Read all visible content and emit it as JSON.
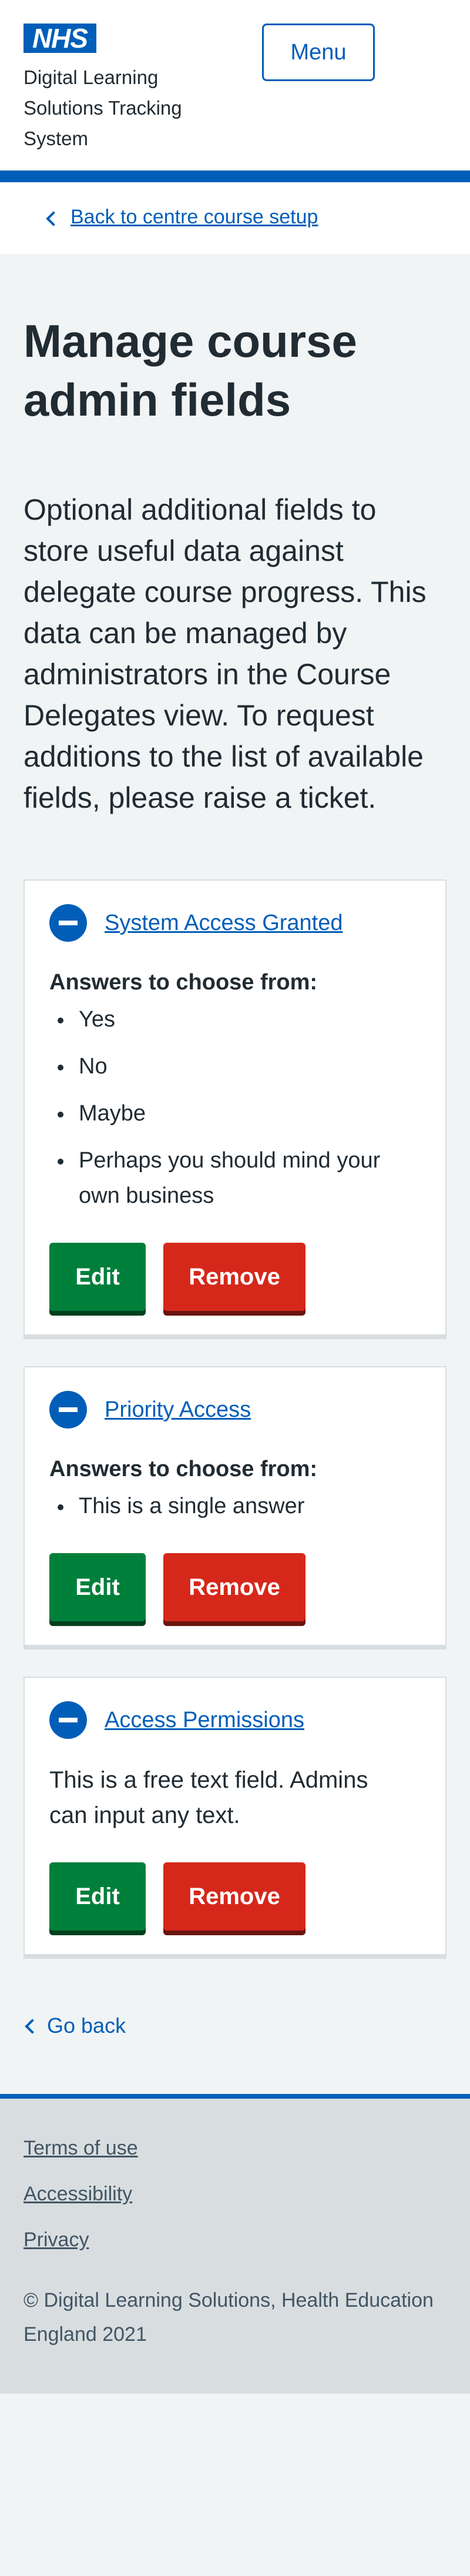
{
  "header": {
    "logo_text": "NHS",
    "service_name": "Digital Learning Solutions Tracking System",
    "menu_label": "Menu"
  },
  "breadcrumb": {
    "back_label": "Back to centre course setup"
  },
  "main": {
    "title": "Manage course admin fields",
    "lede": "Optional additional fields to store useful data against delegate course progress. This data can be managed by administrators in the Course Delegates view. To request additions to the list of available fields, please raise a ticket.",
    "answers_heading": "Answers to choose from:",
    "edit_label": "Edit",
    "remove_label": "Remove",
    "fields": [
      {
        "name": "System Access Granted",
        "answers": [
          "Yes",
          "No",
          "Maybe",
          "Perhaps you should mind your own business"
        ]
      },
      {
        "name": "Priority Access",
        "answers": [
          "This is a single answer"
        ]
      },
      {
        "name": "Access Permissions",
        "free_text": "This is a free text field. Admins can input any text."
      }
    ],
    "go_back_label": "Go back"
  },
  "footer": {
    "links": [
      "Terms of use",
      "Accessibility",
      "Privacy"
    ],
    "copyright": "© Digital Learning Solutions, Health Education England 2021"
  },
  "colors": {
    "nhs_blue": "#005eb8",
    "edit_green": "#007f3b",
    "remove_red": "#d5281b",
    "page_background": "#f0f4f5",
    "footer_background": "#d8dde0"
  }
}
